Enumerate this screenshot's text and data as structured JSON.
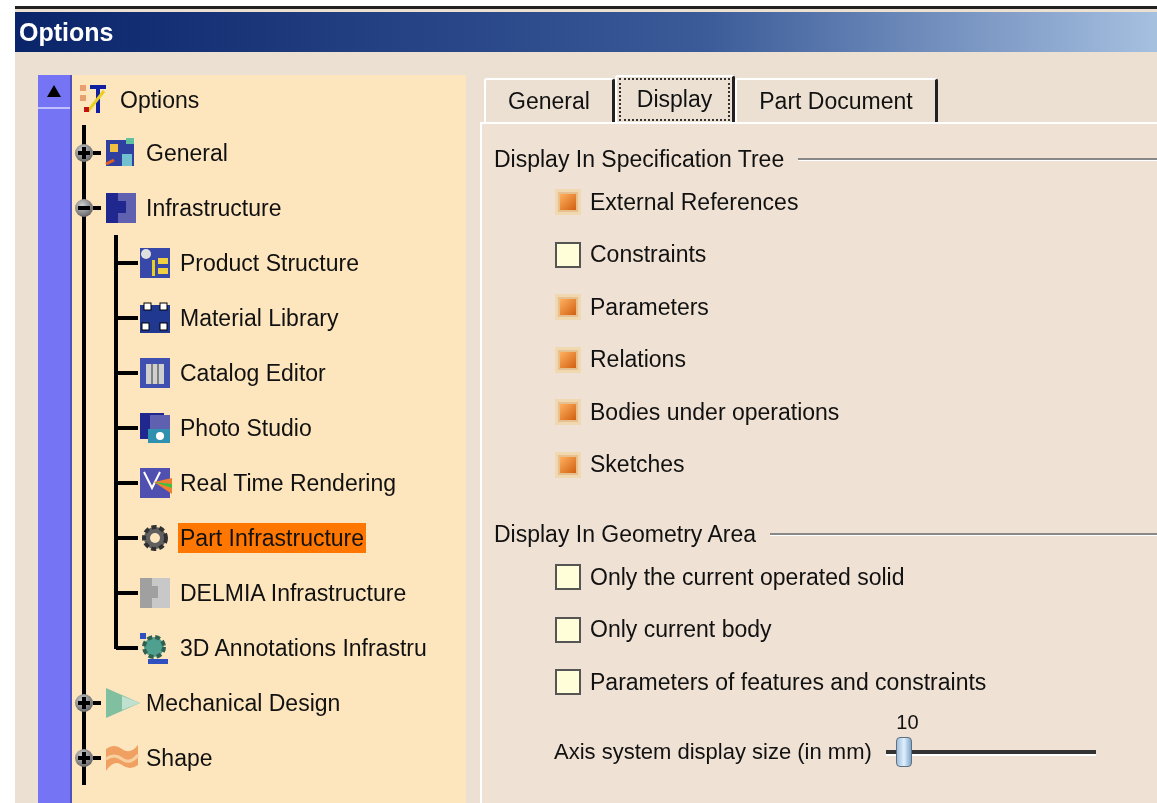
{
  "window": {
    "title": "Options"
  },
  "tree": {
    "root": {
      "label": "Options",
      "selected": false
    },
    "items": [
      {
        "label": "General",
        "selected": false,
        "expanded": false
      },
      {
        "label": "Infrastructure",
        "selected": false,
        "expanded": true,
        "children": [
          {
            "label": "Product Structure",
            "selected": false
          },
          {
            "label": "Material Library",
            "selected": false
          },
          {
            "label": "Catalog Editor",
            "selected": false
          },
          {
            "label": "Photo Studio",
            "selected": false
          },
          {
            "label": "Real Time Rendering",
            "selected": false
          },
          {
            "label": "Part Infrastructure",
            "selected": true
          },
          {
            "label": "DELMIA Infrastructure",
            "selected": false
          },
          {
            "label": "3D Annotations Infrastru",
            "selected": false
          }
        ]
      },
      {
        "label": "Mechanical Design",
        "selected": false,
        "expanded": false
      },
      {
        "label": "Shape",
        "selected": false,
        "expanded": false
      }
    ]
  },
  "tabs": [
    {
      "label": "General",
      "selected": false
    },
    {
      "label": "Display",
      "selected": true
    },
    {
      "label": "Part Document",
      "selected": false
    }
  ],
  "groups": [
    {
      "title": "Display In Specification Tree",
      "options": [
        {
          "label": "External References",
          "checked": true
        },
        {
          "label": "Constraints",
          "checked": false
        },
        {
          "label": "Parameters",
          "checked": true
        },
        {
          "label": "Relations",
          "checked": true
        },
        {
          "label": "Bodies under operations",
          "checked": true
        },
        {
          "label": "Sketches",
          "checked": true
        }
      ]
    },
    {
      "title": "Display In Geometry Area",
      "options": [
        {
          "label": "Only the current operated solid",
          "checked": false
        },
        {
          "label": "Only current body",
          "checked": false
        },
        {
          "label": "Parameters of features and constraints",
          "checked": false
        }
      ],
      "slider": {
        "label": "Axis system display size (in mm)",
        "value": "10",
        "level": 0.05
      }
    }
  ]
}
